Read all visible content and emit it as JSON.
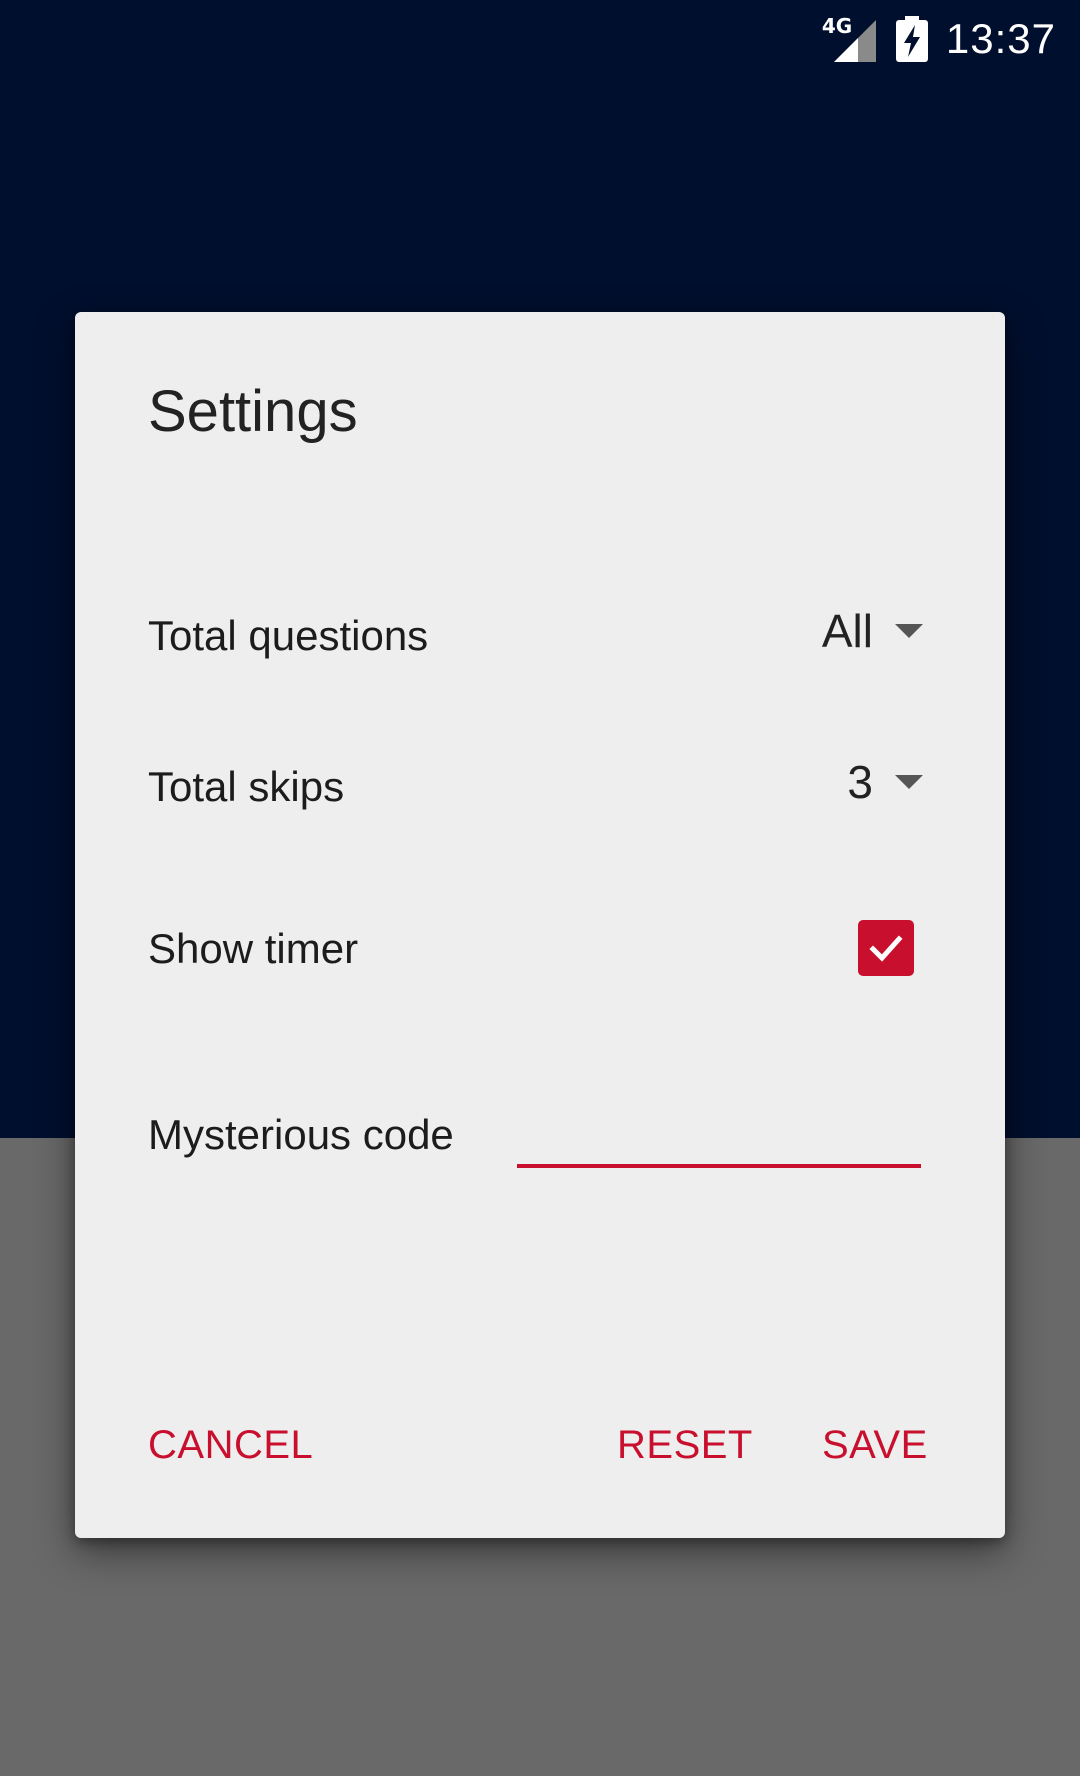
{
  "status_bar": {
    "network": "4G",
    "time": "13:37"
  },
  "dialog": {
    "title": "Settings",
    "rows": {
      "total_questions": {
        "label": "Total questions",
        "value": "All"
      },
      "total_skips": {
        "label": "Total skips",
        "value": "3"
      },
      "show_timer": {
        "label": "Show timer",
        "checked": true
      },
      "mysterious_code": {
        "label": "Mysterious code",
        "value": ""
      }
    },
    "buttons": {
      "cancel": "CANCEL",
      "reset": "RESET",
      "save": "SAVE"
    }
  },
  "colors": {
    "accent": "#c8102e",
    "background_top": "#000f2e",
    "scrim": "#696969",
    "dialog_bg": "#eeeeee"
  },
  "icons": {
    "signal": "signal-icon",
    "battery": "battery-charging-icon",
    "checkbox": "check-icon",
    "dropdown": "chevron-down-icon"
  }
}
